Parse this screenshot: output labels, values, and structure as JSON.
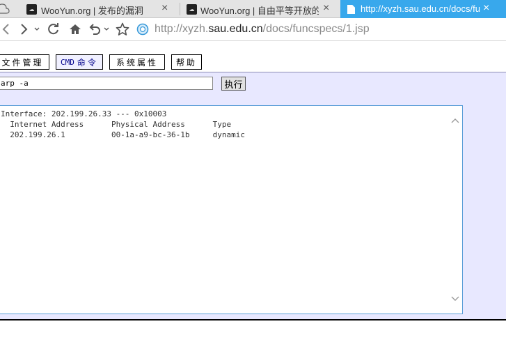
{
  "tabs": [
    {
      "title": "WooYun.org | 发布的漏洞",
      "close": "×"
    },
    {
      "title": "WooYun.org | 自由平等开放的",
      "close": "×"
    },
    {
      "title": "http://xyzh.sau.edu.cn/docs/fu",
      "close": "×"
    }
  ],
  "toolbar": {
    "url_prefix": "http://xyzh.",
    "url_domain": "sau.edu.cn",
    "url_suffix": "/docs/funcspecs/1.jsp"
  },
  "menu": {
    "file_manage": "文件管理",
    "cmd_prefix": "CMD",
    "cmd_rest": "命令",
    "sys_props": "系统属性",
    "help": "帮助"
  },
  "command": {
    "value": "arp -a",
    "exec_label": "执行"
  },
  "output": {
    "text": "Interface: 202.199.26.33 --- 0x10003\n  Internet Address      Physical Address      Type\n  202.199.26.1          00-1a-a9-bc-36-1b     dynamic"
  },
  "colors": {
    "active_tab": "#38a8ec",
    "content_bg": "#e8e8ff",
    "output_border": "#5c9ed8"
  }
}
